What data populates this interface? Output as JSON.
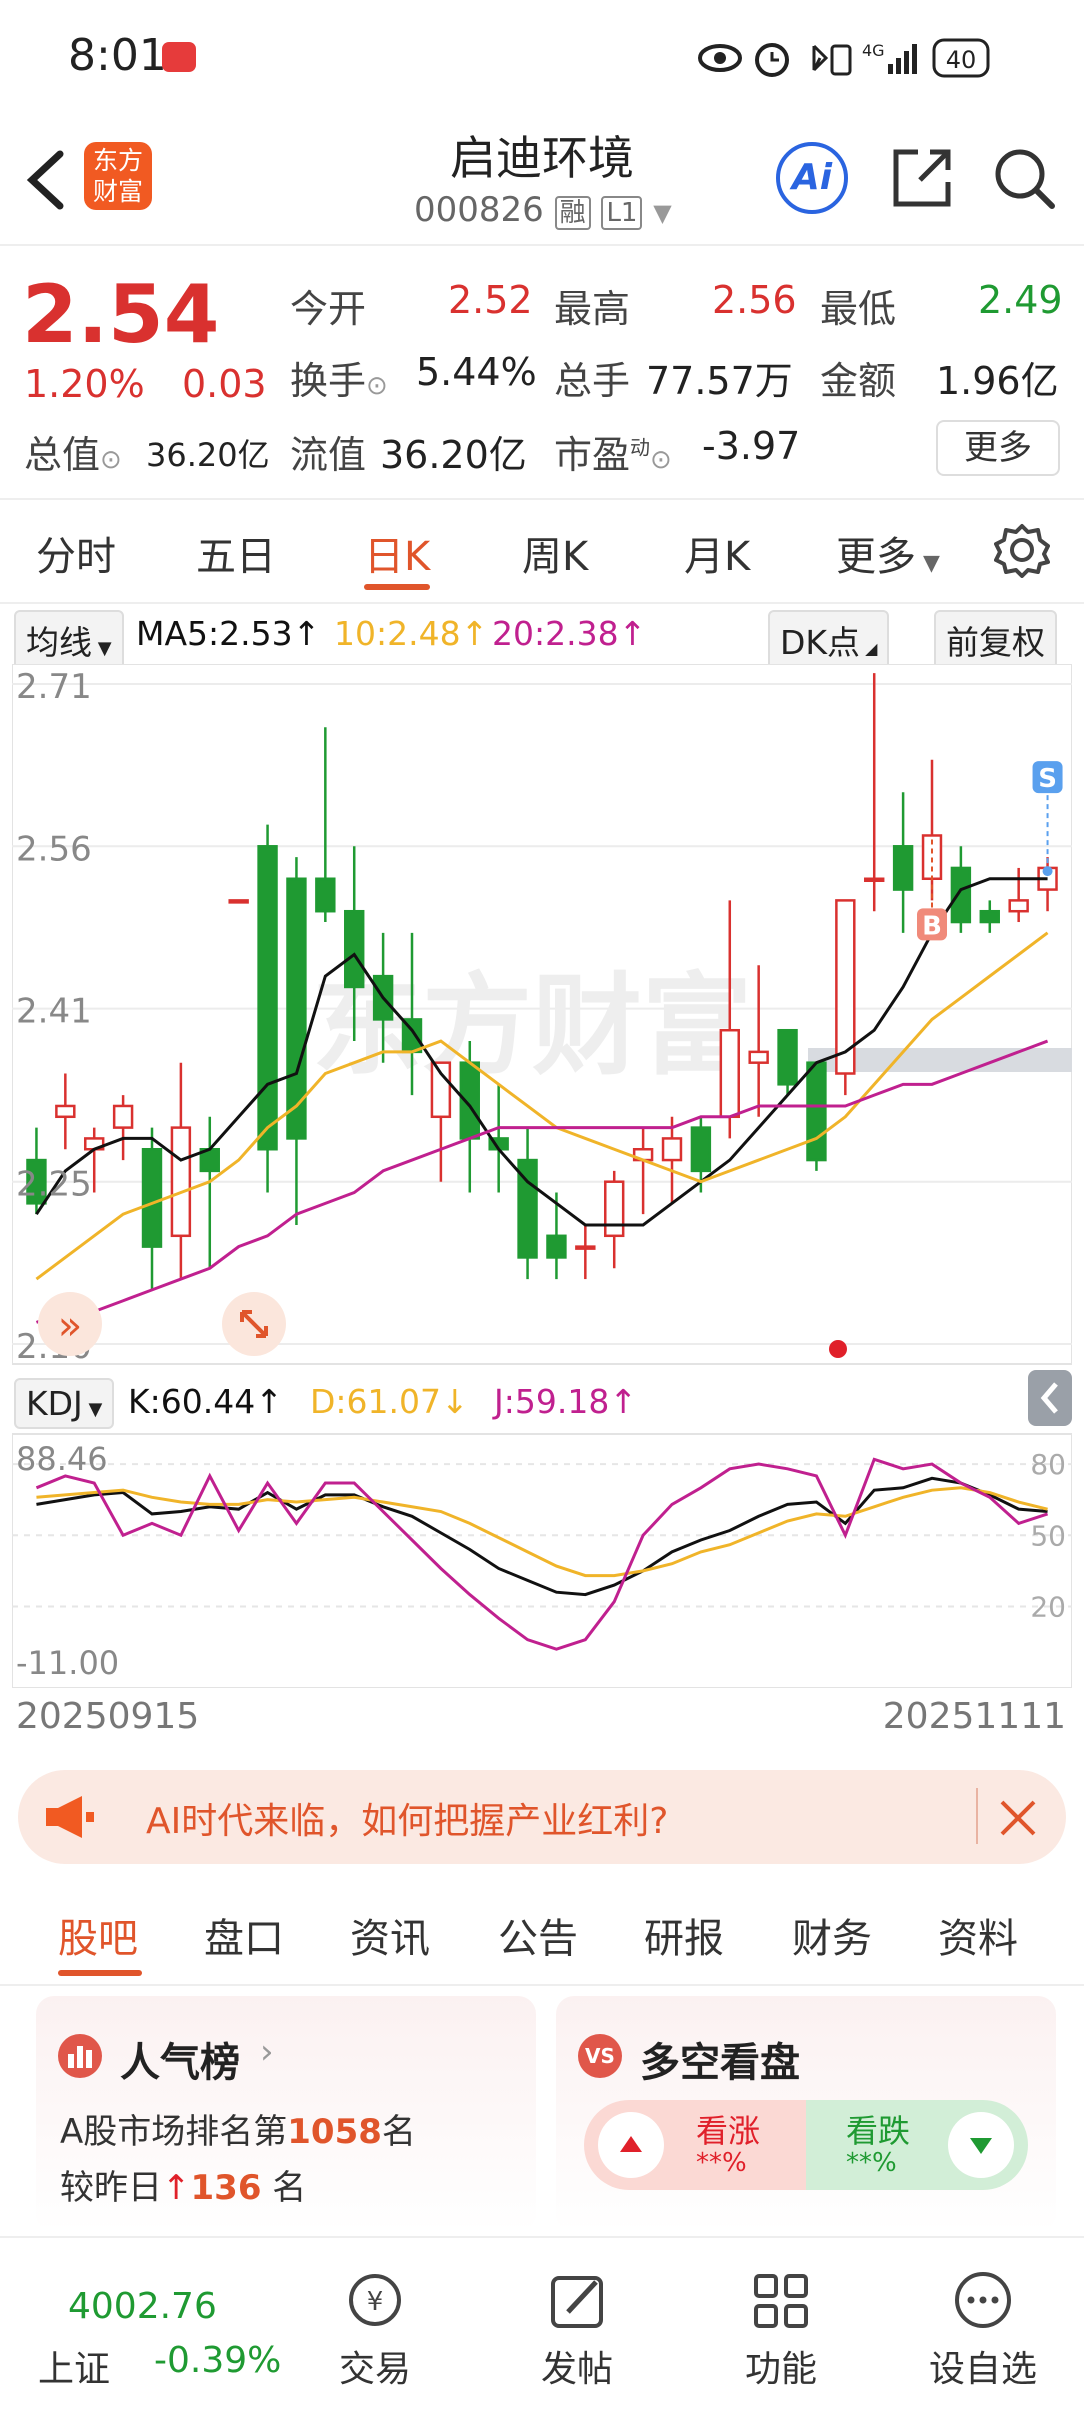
{
  "status": {
    "time": "8:01",
    "net": "4G",
    "battery": "40"
  },
  "header": {
    "title": "启迪环境",
    "code": "000826",
    "badge_margin": "融",
    "badge_level": "L1",
    "logo_top": "东方",
    "logo_bottom": "财富",
    "ai_label": "Ai"
  },
  "quote": {
    "price": "2.54",
    "change_pct": "1.20%",
    "change": "0.03",
    "open_label": "今开",
    "open": "2.52",
    "high_label": "最高",
    "high": "2.56",
    "low_label": "最低",
    "low": "2.49",
    "turnover_label": "换手",
    "turnover": "5.44%",
    "volume_label": "总手",
    "volume": "77.57万",
    "amount_label": "金额",
    "amount": "1.96亿",
    "mktcap_label": "总值",
    "mktcap": "36.20亿",
    "float_label": "流值",
    "float": "36.20亿",
    "pe_label": "市盈",
    "pe_sup": "动",
    "pe": "-3.97",
    "more": "更多"
  },
  "period_tabs": [
    "分时",
    "五日",
    "日K",
    "周K",
    "月K",
    "更多"
  ],
  "ma": {
    "selector": "均线",
    "ma5": "MA5:2.53↑",
    "ma10": "10:2.48↑",
    "ma20": "20:2.38↑",
    "dk": "DK点",
    "adjust": "前复权"
  },
  "colors": {
    "up": "#d9312f",
    "down": "#1f9a32",
    "ma5": "#111111",
    "ma10": "#f0b429",
    "ma20": "#c0208f",
    "accent": "#e0552b"
  },
  "kdj": {
    "selector": "KDJ",
    "k": "K:60.44↑",
    "d": "D:61.07↓",
    "j": "J:59.18↑"
  },
  "chart_data": {
    "type": "candlestick",
    "y_ticks": [
      "2.71",
      "2.56",
      "2.41",
      "2.25",
      "2.10"
    ],
    "ylim": [
      2.1,
      2.71
    ],
    "candles": [
      [
        2.27,
        2.23,
        2.3,
        2.22
      ],
      [
        2.31,
        2.32,
        2.35,
        2.28
      ],
      [
        2.28,
        2.29,
        2.3,
        2.24
      ],
      [
        2.3,
        2.32,
        2.33,
        2.27
      ],
      [
        2.28,
        2.19,
        2.3,
        2.15
      ],
      [
        2.2,
        2.3,
        2.36,
        2.16
      ],
      [
        2.28,
        2.26,
        2.31,
        2.17
      ],
      [
        2.51,
        2.51,
        2.51,
        2.51
      ],
      [
        2.56,
        2.28,
        2.58,
        2.24
      ],
      [
        2.53,
        2.29,
        2.55,
        2.21
      ],
      [
        2.53,
        2.5,
        2.67,
        2.49
      ],
      [
        2.5,
        2.43,
        2.56,
        2.38
      ],
      [
        2.44,
        2.4,
        2.48,
        2.36
      ],
      [
        2.4,
        2.37,
        2.48,
        2.33
      ],
      [
        2.31,
        2.36,
        2.36,
        2.25
      ],
      [
        2.36,
        2.29,
        2.38,
        2.24
      ],
      [
        2.29,
        2.28,
        2.34,
        2.24
      ],
      [
        2.27,
        2.18,
        2.3,
        2.16
      ],
      [
        2.2,
        2.18,
        2.24,
        2.16
      ],
      [
        2.19,
        2.19,
        2.21,
        2.16
      ],
      [
        2.2,
        2.25,
        2.26,
        2.17
      ],
      [
        2.27,
        2.28,
        2.3,
        2.22
      ],
      [
        2.27,
        2.29,
        2.31,
        2.23
      ],
      [
        2.3,
        2.26,
        2.31,
        2.24
      ],
      [
        2.31,
        2.39,
        2.51,
        2.29
      ],
      [
        2.36,
        2.37,
        2.45,
        2.31
      ],
      [
        2.39,
        2.34,
        2.39,
        2.33
      ],
      [
        2.36,
        2.27,
        2.36,
        2.26
      ],
      [
        2.35,
        2.51,
        2.51,
        2.33
      ],
      [
        2.53,
        2.53,
        2.72,
        2.5
      ],
      [
        2.56,
        2.52,
        2.61,
        2.48
      ],
      [
        2.53,
        2.57,
        2.64,
        2.51
      ],
      [
        2.54,
        2.49,
        2.56,
        2.48
      ],
      [
        2.5,
        2.49,
        2.51,
        2.48
      ],
      [
        2.5,
        2.51,
        2.54,
        2.49
      ],
      [
        2.52,
        2.54,
        2.55,
        2.5
      ]
    ],
    "ma5": [
      2.22,
      2.26,
      2.28,
      2.29,
      2.29,
      2.27,
      2.28,
      2.31,
      2.34,
      2.35,
      2.44,
      2.46,
      2.42,
      2.39,
      2.35,
      2.32,
      2.28,
      2.25,
      2.23,
      2.21,
      2.21,
      2.21,
      2.23,
      2.25,
      2.27,
      2.3,
      2.33,
      2.36,
      2.37,
      2.39,
      2.43,
      2.48,
      2.52,
      2.53,
      2.53,
      2.53
    ],
    "ma10": [
      2.16,
      2.18,
      2.2,
      2.22,
      2.23,
      2.24,
      2.25,
      2.27,
      2.3,
      2.32,
      2.35,
      2.36,
      2.37,
      2.37,
      2.38,
      2.36,
      2.34,
      2.32,
      2.3,
      2.29,
      2.28,
      2.27,
      2.26,
      2.25,
      2.26,
      2.27,
      2.28,
      2.29,
      2.31,
      2.34,
      2.37,
      2.4,
      2.42,
      2.44,
      2.46,
      2.48
    ],
    "ma20": [
      2.12,
      2.13,
      2.13,
      2.14,
      2.15,
      2.16,
      2.17,
      2.19,
      2.2,
      2.22,
      2.23,
      2.24,
      2.26,
      2.27,
      2.28,
      2.29,
      2.3,
      2.3,
      2.3,
      2.3,
      2.3,
      2.3,
      2.3,
      2.31,
      2.31,
      2.32,
      2.32,
      2.32,
      2.32,
      2.33,
      2.34,
      2.34,
      2.35,
      2.36,
      2.37,
      2.38
    ],
    "markers": {
      "buy_label": "B",
      "buy_index": 31,
      "sell_label": "S",
      "sell_index": 35
    },
    "kdj_ticks": [
      "88.46",
      "-11.00"
    ],
    "kdj_right_ticks": [
      "80",
      "50",
      "20"
    ],
    "k": [
      63,
      65,
      67,
      68,
      59,
      60,
      62,
      61,
      68,
      61,
      67,
      67,
      62,
      58,
      51,
      44,
      36,
      31,
      26,
      25,
      29,
      35,
      43,
      48,
      52,
      58,
      63,
      64,
      55,
      69,
      70,
      74,
      72,
      67,
      61,
      60
    ],
    "d": [
      66,
      67,
      68,
      69,
      66,
      64,
      63,
      63,
      65,
      64,
      65,
      66,
      64,
      62,
      60,
      55,
      49,
      43,
      37,
      33,
      33,
      35,
      38,
      43,
      46,
      51,
      56,
      59,
      58,
      62,
      66,
      69,
      70,
      68,
      64,
      61
    ],
    "j": [
      70,
      75,
      72,
      50,
      55,
      50,
      75,
      52,
      72,
      55,
      72,
      72,
      60,
      48,
      36,
      25,
      15,
      6,
      2,
      6,
      22,
      50,
      63,
      70,
      78,
      80,
      78,
      75,
      50,
      82,
      78,
      80,
      72,
      66,
      55,
      59
    ],
    "start_date": "20250915",
    "end_date": "20251111"
  },
  "banner": {
    "text": "AI时代来临，如何把握产业红利?"
  },
  "subtabs": [
    "股吧",
    "盘口",
    "资讯",
    "公告",
    "研报",
    "财务",
    "资料"
  ],
  "popularity": {
    "title": "人气榜",
    "line1_prefix": "A股市场排名第",
    "rank": "1058",
    "line1_suffix": "名",
    "line2_prefix": "较昨日",
    "delta": "136",
    "line2_suffix": "名"
  },
  "sentiment": {
    "title": "多空看盘",
    "bull_label": "看涨",
    "bull_value": "**%",
    "bear_label": "看跌",
    "bear_value": "**%"
  },
  "bottom": {
    "index_value": "4002.76",
    "index_name": "上证",
    "index_change": "-0.39%",
    "trade": "交易",
    "post": "发帖",
    "func": "功能",
    "watch": "设自选"
  }
}
